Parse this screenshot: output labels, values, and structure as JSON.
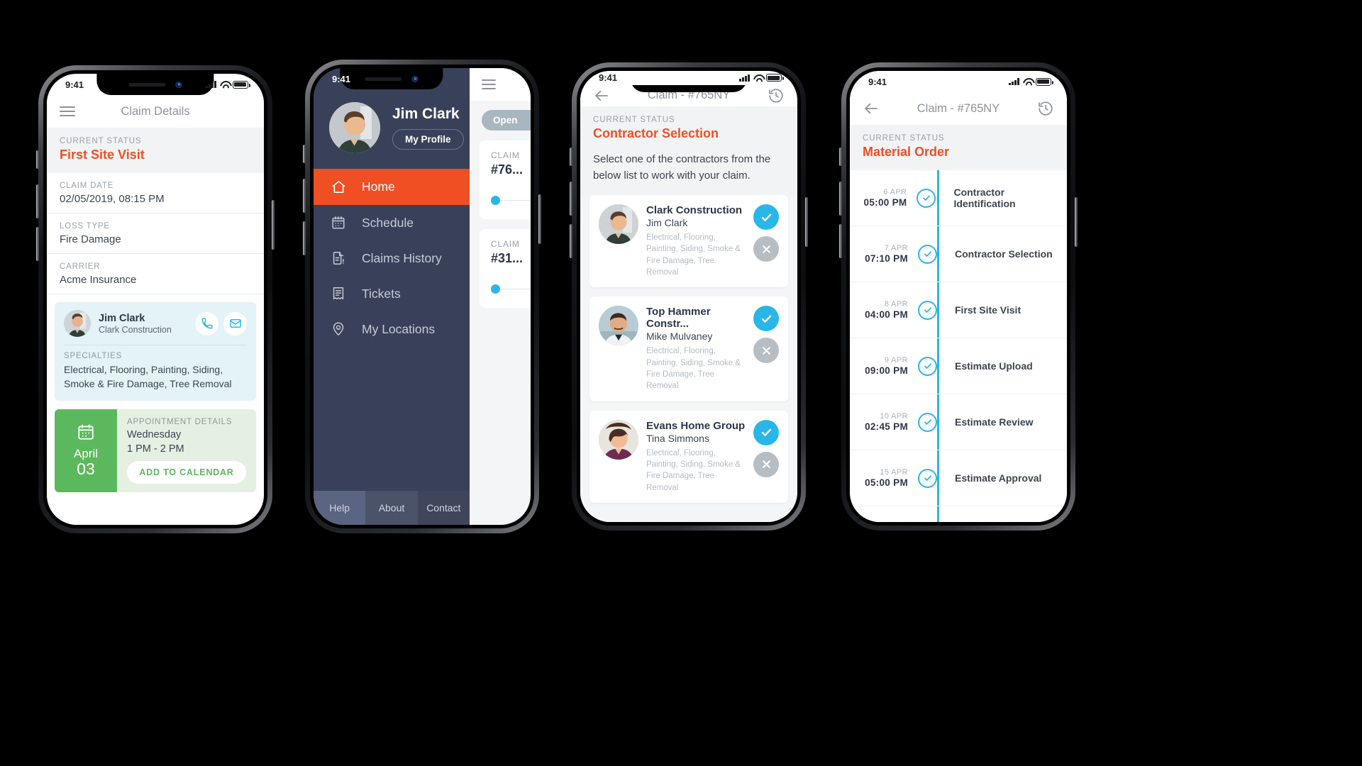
{
  "status_bar": {
    "time": "9:41"
  },
  "phone1": {
    "appbar": {
      "title": "Claim Details",
      "menu_icon": "hamburger-icon"
    },
    "status": {
      "label": "CURRENT STATUS",
      "value": "First Site Visit",
      "color": "#f04e23"
    },
    "fields": [
      {
        "label": "CLAIM DATE",
        "value": "02/05/2019, 08:15 PM"
      },
      {
        "label": "LOSS TYPE",
        "value": "Fire Damage"
      },
      {
        "label": "CARRIER",
        "value": "Acme Insurance"
      }
    ],
    "contact": {
      "name": "Jim Clark",
      "org": "Clark Construction",
      "phone_icon": "phone-icon",
      "email_icon": "envelope-icon",
      "specialties_label": "SPECIALTIES",
      "specialties": "Electrical, Flooring, Painting, Siding, Smoke & Fire Damage, Tree Removal"
    },
    "appointment": {
      "month": "April",
      "day": "03",
      "calendar_icon": "calendar-icon",
      "title": "APPOINTMENT DETAILS",
      "day_name": "Wednesday",
      "time_range": "1 PM - 2 PM",
      "button": "ADD TO CALENDAR"
    }
  },
  "phone2": {
    "user": {
      "name": "Jim Clark",
      "profile_button": "My Profile"
    },
    "menu": [
      {
        "label": "Home",
        "icon": "home-icon",
        "active": true
      },
      {
        "label": "Schedule",
        "icon": "calendar-icon",
        "active": false
      },
      {
        "label": "Claims History",
        "icon": "document-alert-icon",
        "active": false
      },
      {
        "label": "Tickets",
        "icon": "receipt-icon",
        "active": false
      },
      {
        "label": "My Locations",
        "icon": "map-pin-icon",
        "active": false
      }
    ],
    "footer": [
      "Help",
      "About",
      "Contact"
    ],
    "peek": {
      "menu_icon": "hamburger-icon",
      "pill": "Open",
      "cards": [
        {
          "label": "CLAIM",
          "number": "#76..."
        },
        {
          "label": "CLAIM",
          "number": "#31..."
        }
      ]
    },
    "accent": "#f04e23",
    "bg": "#39415a"
  },
  "phone3": {
    "appbar": {
      "back_icon": "back-arrow-icon",
      "title": "Claim - #765NY",
      "history_icon": "history-icon"
    },
    "status": {
      "label": "CURRENT STATUS",
      "value": "Contractor Selection"
    },
    "intro": "Select one of the contractors from the below list to work with your claim.",
    "contractors": [
      {
        "company": "Clark Construction",
        "person": "Jim Clark",
        "specialties": "Electrical, Flooring, Painting, Siding, Smoke & Fire Damage, Tree Removal",
        "accept_icon": "check-icon",
        "reject_icon": "close-icon"
      },
      {
        "company": "Top Hammer Constr...",
        "person": "Mike Mulvaney",
        "specialties": "Electrical, Flooring, Painting, Siding, Smoke & Fire Damage, Tree Removal",
        "accept_icon": "check-icon",
        "reject_icon": "close-icon"
      },
      {
        "company": "Evans Home Group",
        "person": "Tina Simmons",
        "specialties": "Electrical, Flooring, Painting, Siding, Smoke & Fire Damage, Tree Removal",
        "accept_icon": "check-icon",
        "reject_icon": "close-icon"
      }
    ]
  },
  "phone4": {
    "appbar": {
      "back_icon": "back-arrow-icon",
      "title": "Claim - #765NY",
      "history_icon": "history-icon"
    },
    "status": {
      "label": "CURRENT STATUS",
      "value": "Material Order"
    },
    "timeline": [
      {
        "date": "6 APR",
        "time": "05:00 PM",
        "label": "Contractor Identification",
        "icon": "check-circle-icon"
      },
      {
        "date": "7 APR",
        "time": "07:10 PM",
        "label": "Contractor Selection",
        "icon": "check-circle-icon"
      },
      {
        "date": "8 APR",
        "time": "04:00 PM",
        "label": "First Site Visit",
        "icon": "check-circle-icon"
      },
      {
        "date": "9 APR",
        "time": "09:00 PM",
        "label": "Estimate Upload",
        "icon": "check-circle-icon"
      },
      {
        "date": "10 APR",
        "time": "02:45 PM",
        "label": "Estimate Review",
        "icon": "check-circle-icon"
      },
      {
        "date": "15 APR",
        "time": "05:00 PM",
        "label": "Estimate Approval",
        "icon": "check-circle-icon"
      }
    ]
  }
}
